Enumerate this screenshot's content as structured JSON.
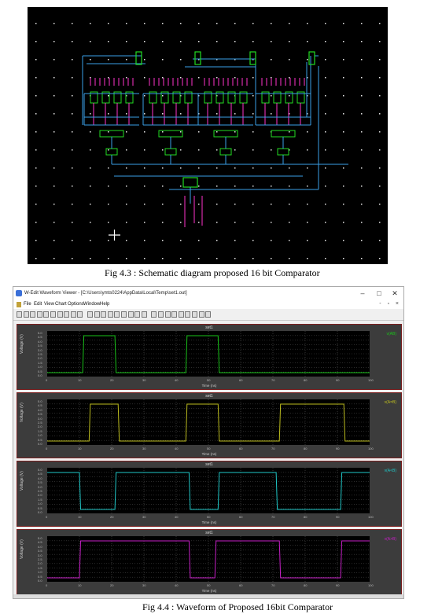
{
  "figure_43": {
    "caption": "Fig 4.3 : Schematic diagram proposed 16 bit Comparator"
  },
  "figure_44": {
    "caption": "Fig 4.4 : Waveform of  Proposed 16bit Comparator"
  },
  "window": {
    "title": "W-Edit Waveform Viewer - [C:\\Users\\ymts0224\\AppData\\Local\\Temp\\set1.out]",
    "controls": [
      "–",
      "□",
      "✕"
    ],
    "menu": [
      "File",
      "Edit",
      "View",
      "Chart",
      "Options",
      "Window",
      "Help"
    ],
    "mdi_controls": "- ▫ ×"
  },
  "plots": [
    {
      "title": "set1",
      "ylabel": "Voltage (V)",
      "xlabel": "Time (ns)",
      "legend": "v(AB)",
      "color": "#19c219",
      "transitions": [
        11,
        21,
        43,
        53
      ],
      "start_high": false
    },
    {
      "title": "set1",
      "ylabel": "Voltage (V)",
      "xlabel": "Time (ns)",
      "legend": "v(A=B)",
      "color": "#bcbc1e",
      "transitions": [
        13,
        22,
        43,
        53,
        72,
        92
      ],
      "start_high": false
    },
    {
      "title": "set1",
      "ylabel": "Voltage (V)",
      "xlabel": "Time (ns)",
      "legend": "v(A<B)",
      "color": "#1fc7c7",
      "transitions": [
        10,
        21,
        44,
        53,
        71,
        91
      ],
      "start_high": true
    },
    {
      "title": "set1",
      "ylabel": "Voltage (V)",
      "xlabel": "Time (ns)",
      "legend": "v(A>B)",
      "color": "#c71fc7",
      "transitions": [
        10,
        44,
        52,
        72,
        91
      ],
      "start_high": false
    }
  ],
  "yticks": [
    "5.0",
    "4.5",
    "4.0",
    "3.5",
    "3.0",
    "2.5",
    "2.0",
    "1.5",
    "1.0",
    "0.5",
    "0.0"
  ],
  "xticks": [
    "0",
    "10",
    "20",
    "30",
    "40",
    "50",
    "60",
    "70",
    "80",
    "90",
    "100"
  ]
}
